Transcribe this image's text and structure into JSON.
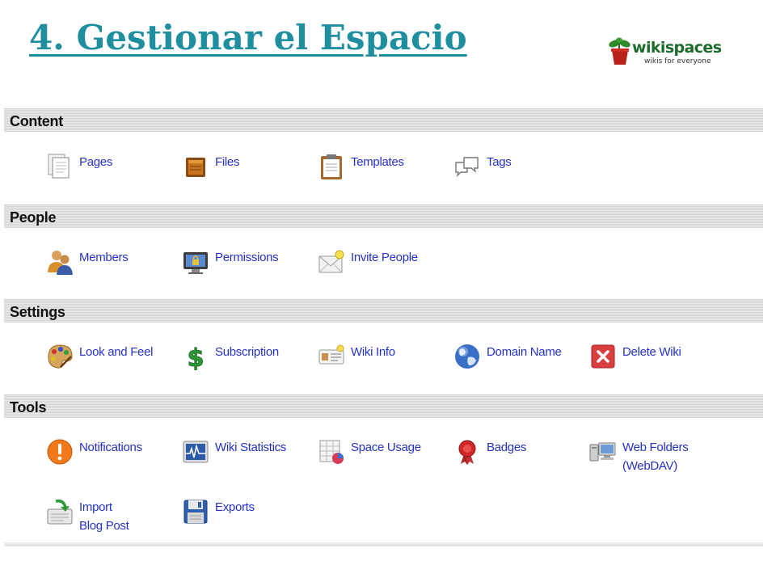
{
  "slide": {
    "title": "4. Gestionar el Espacio"
  },
  "logo": {
    "name": "wikispaces",
    "tagline": "wikis for everyone"
  },
  "sections": {
    "content": {
      "title": "Content",
      "items": [
        {
          "label": "Pages",
          "icon": "pages-icon"
        },
        {
          "label": "Files",
          "icon": "files-icon"
        },
        {
          "label": "Templates",
          "icon": "templates-icon"
        },
        {
          "label": "Tags",
          "icon": "tags-icon"
        }
      ]
    },
    "people": {
      "title": "People",
      "items": [
        {
          "label": "Members",
          "icon": "members-icon"
        },
        {
          "label": "Permissions",
          "icon": "permissions-icon"
        },
        {
          "label": "Invite People",
          "icon": "invite-people-icon"
        }
      ]
    },
    "settings": {
      "title": "Settings",
      "items": [
        {
          "label": "Look and Feel",
          "icon": "look-and-feel-icon"
        },
        {
          "label": "Subscription",
          "icon": "subscription-icon"
        },
        {
          "label": "Wiki Info",
          "icon": "wiki-info-icon"
        },
        {
          "label": "Domain Name",
          "icon": "domain-name-icon"
        },
        {
          "label": "Delete Wiki",
          "icon": "delete-wiki-icon"
        }
      ]
    },
    "tools": {
      "title": "Tools",
      "items": [
        {
          "label": "Notifications",
          "icon": "notifications-icon"
        },
        {
          "label": "Wiki Statistics",
          "icon": "wiki-statistics-icon"
        },
        {
          "label": "Space Usage",
          "icon": "space-usage-icon"
        },
        {
          "label": "Badges",
          "icon": "badges-icon"
        },
        {
          "label": "Web Folders",
          "label2": "(WebDAV)",
          "icon": "web-folders-icon"
        },
        {
          "label": "Import",
          "label2": "Blog Post",
          "icon": "import-blog-post-icon"
        },
        {
          "label": "Exports",
          "icon": "exports-icon"
        }
      ]
    }
  },
  "colors": {
    "title": "#1f8fa0",
    "link": "#2532c8",
    "header_text": "#111111",
    "logo_green": "#1b6b2a"
  }
}
